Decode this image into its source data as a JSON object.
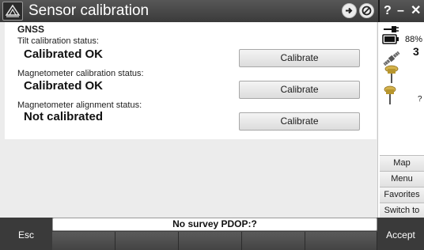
{
  "title": "Sensor calibration",
  "group": "GNSS",
  "rows": [
    {
      "label": "Tilt calibration status:",
      "status": "Calibrated OK",
      "button": "Calibrate"
    },
    {
      "label": "Magnetometer calibration status:",
      "status": "Calibrated OK",
      "button": "Calibrate"
    },
    {
      "label": "Magnetometer alignment status:",
      "status": "Not calibrated",
      "button": "Calibrate"
    }
  ],
  "window_controls": {
    "help": "?",
    "minimize": "–",
    "close": "✕"
  },
  "side": {
    "battery": "88%",
    "satellites": "3",
    "receiver_status": "?"
  },
  "menu": [
    "Map",
    "Menu",
    "Favorites",
    "Switch to"
  ],
  "bottom": {
    "esc": "Esc",
    "status": "No survey  PDOP:?",
    "accept": "Accept"
  },
  "colors": {
    "titlebar": "#444444",
    "background": "#ececec",
    "receiver": "#d4b24c"
  }
}
